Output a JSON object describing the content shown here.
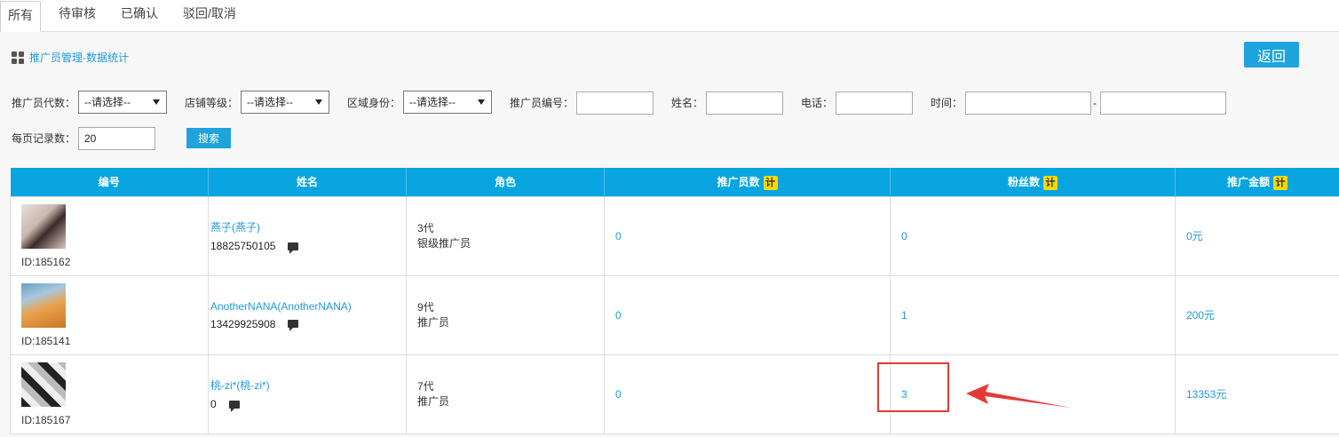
{
  "tabs": [
    {
      "label": "所有"
    },
    {
      "label": "待审核"
    },
    {
      "label": "已确认"
    },
    {
      "label": "驳回/取消"
    }
  ],
  "breadcrumb": "推广员管理-数据统计",
  "back_label": "返回",
  "filters": {
    "generation_label": "推广员代数：",
    "generation_value": "--请选择--",
    "store_level_label": "店铺等级：",
    "store_level_value": "--请选择--",
    "region_label": "区域身份：",
    "region_value": "--请选择--",
    "promoter_id_label": "推广员编号：",
    "name_label": "姓名：",
    "phone_label": "电话：",
    "time_label": "时间：",
    "time_sep": "-",
    "per_page_label": "每页记录数：",
    "per_page_value": "20",
    "search_label": "搜索"
  },
  "table": {
    "headers": {
      "id": "编号",
      "name": "姓名",
      "role": "角色",
      "promoters": "推广员数",
      "fans": "粉丝数",
      "amount": "推广金额",
      "calc_badge": "计"
    },
    "rows": [
      {
        "id": "ID:185162",
        "name": "燕子(燕子)",
        "phone": "18825750105",
        "role_gen": "3代",
        "role_title": "银级推广员",
        "promoters": "0",
        "fans": "0",
        "amount": "0元"
      },
      {
        "id": "ID:185141",
        "name": "AnotherNANA(AnotherNANA)",
        "phone": "13429925908",
        "role_gen": "9代",
        "role_title": "推广员",
        "promoters": "0",
        "fans": "1",
        "amount": "200元"
      },
      {
        "id": "ID:185167",
        "name": "桃-zi*(桃-zi*)",
        "phone": "0",
        "role_gen": "7代",
        "role_title": "推广员",
        "promoters": "0",
        "fans": "3",
        "amount": "13353元"
      }
    ]
  },
  "colors": {
    "accent": "#1ea3dc",
    "header_bg": "#08a5e0",
    "highlight": "#e43a36",
    "badge": "#f5d800"
  }
}
